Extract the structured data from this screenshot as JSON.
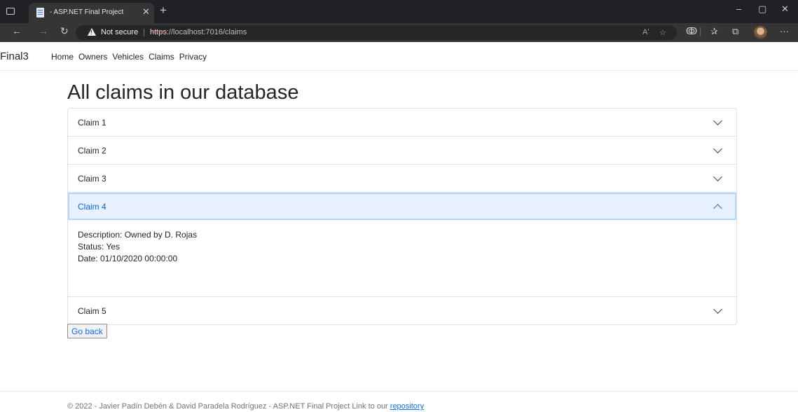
{
  "browser": {
    "tab_title": "- ASP.NET Final Project",
    "not_secure": "Not secure",
    "url_scheme": "https",
    "url_rest": "://localhost:7016/claims",
    "read_aloud": "Aʹ"
  },
  "site": {
    "brand": "Final3",
    "nav": [
      "Home",
      "Owners",
      "Vehicles",
      "Claims",
      "Privacy"
    ]
  },
  "page": {
    "title": "All claims in our database",
    "claims": [
      {
        "label": "Claim 1"
      },
      {
        "label": "Claim 2"
      },
      {
        "label": "Claim 3"
      },
      {
        "label": "Claim 4",
        "description": "Description: Owned by D. Rojas",
        "status": "Status: Yes",
        "date": "Date: 01/10/2020 00:00:00"
      },
      {
        "label": "Claim 5"
      }
    ],
    "back_button": "Go back"
  },
  "footer": {
    "text": "© 2022 - Javier Padín Debén & David Paradela Rodríguez - ASP.NET Final Project Link to our ",
    "link": "repository"
  },
  "colors": {
    "accent": "#0c63e4",
    "open_header_bg": "#e7f1ff",
    "chrome_dark": "#202124"
  }
}
